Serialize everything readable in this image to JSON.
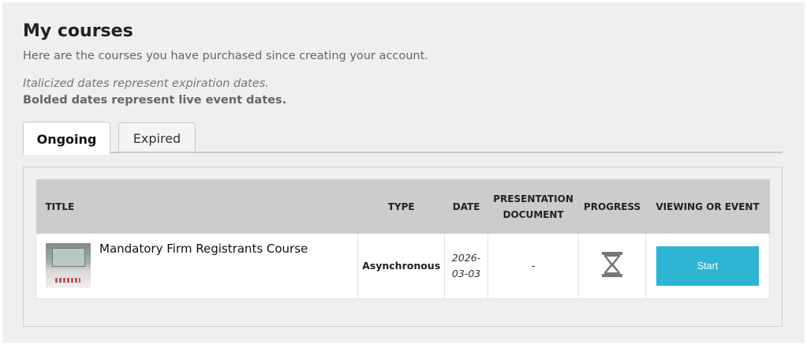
{
  "header": {
    "title": "My courses",
    "subtitle": "Here are the courses you have purchased since creating your account.",
    "note_italic": "Italicized dates represent expiration dates.",
    "note_bold": "Bolded dates represent live event dates."
  },
  "tabs": [
    {
      "label": "Ongoing",
      "active": true
    },
    {
      "label": "Expired",
      "active": false
    }
  ],
  "table": {
    "columns": [
      "TITLE",
      "TYPE",
      "DATE",
      "PRESENTATION DOCUMENT",
      "PROGRESS",
      "VIEWING OR EVENT"
    ],
    "column_presentation_line1": "PRESENTATION",
    "column_presentation_line2": "DOCUMENT",
    "rows": [
      {
        "title": "Mandatory Firm Registrants Course",
        "type": "Asynchronous",
        "date_line1": "2026-",
        "date_line2": "03-03",
        "presentation_document": "-",
        "progress_icon": "hourglass-icon",
        "action_label": "Start"
      }
    ]
  },
  "colors": {
    "accent": "#2db5d3",
    "header_bg": "#cccccc",
    "panel_bg": "#efefef"
  }
}
